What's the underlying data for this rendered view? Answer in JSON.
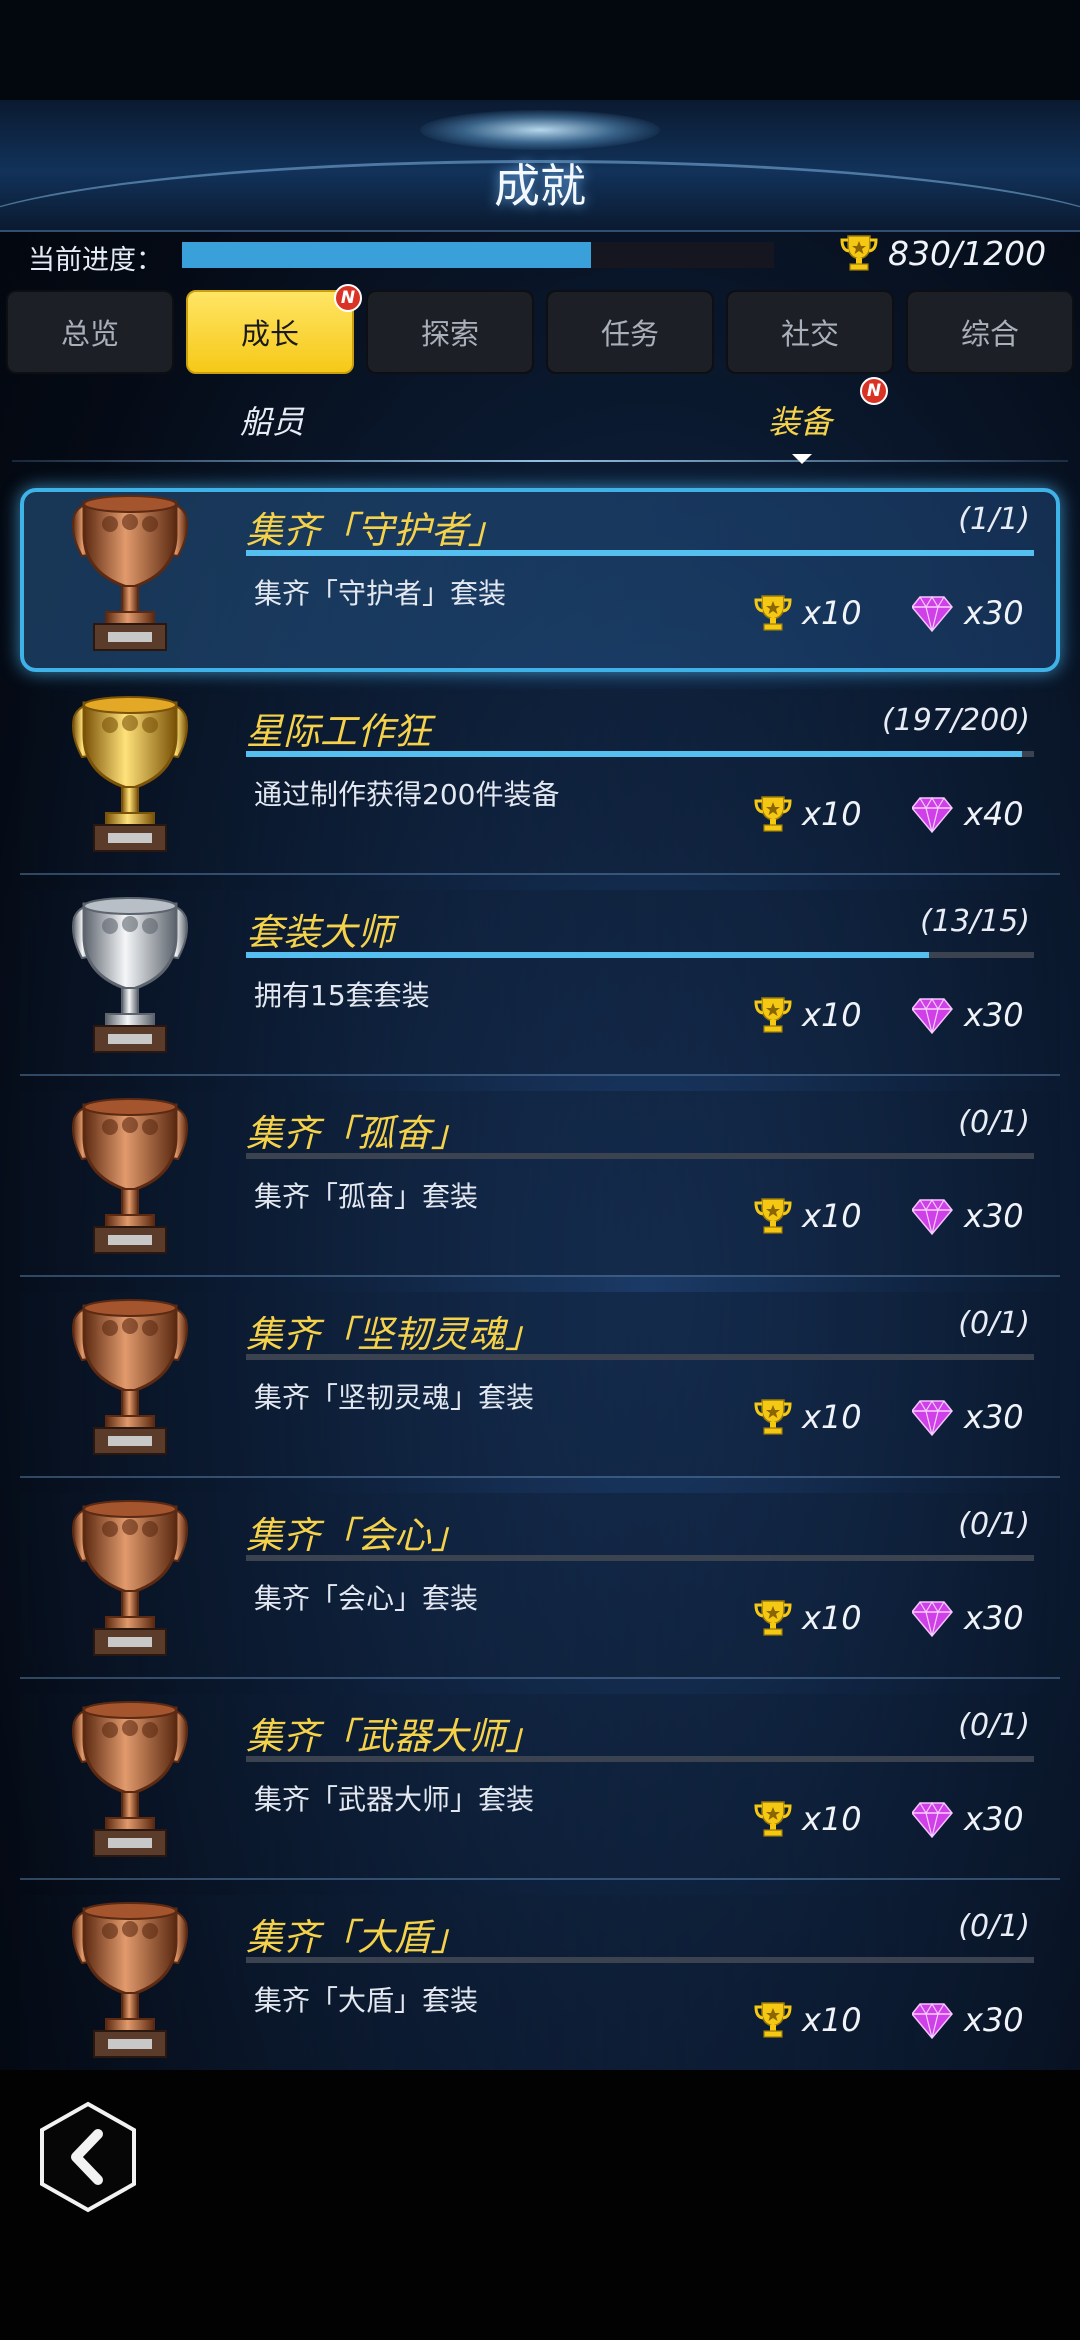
{
  "header": {
    "title": "成就"
  },
  "progress": {
    "label": "当前进度：",
    "current": 830,
    "total": 1200,
    "text": "830/1200"
  },
  "tabs": [
    {
      "label": "总览",
      "active": false,
      "badge": ""
    },
    {
      "label": "成长",
      "active": true,
      "badge": "N"
    },
    {
      "label": "探索",
      "active": false,
      "badge": ""
    },
    {
      "label": "任务",
      "active": false,
      "badge": ""
    },
    {
      "label": "社交",
      "active": false,
      "badge": ""
    },
    {
      "label": "综合",
      "active": false,
      "badge": ""
    }
  ],
  "subtabs": [
    {
      "label": "船员",
      "active": false,
      "badge": ""
    },
    {
      "label": "装备",
      "active": true,
      "badge": "N"
    }
  ],
  "achievements": [
    {
      "title": "集齐「守护者」",
      "desc": "集齐「守护者」套装",
      "progress_text": "(1/1)",
      "current": 1,
      "total": 1,
      "trophy": "bronze",
      "reward_trophy": "x10",
      "reward_gem": "x30",
      "highlight": true
    },
    {
      "title": "星际工作狂",
      "desc": "通过制作获得200件装备",
      "progress_text": "(197/200)",
      "current": 197,
      "total": 200,
      "trophy": "gold",
      "reward_trophy": "x10",
      "reward_gem": "x40",
      "highlight": false
    },
    {
      "title": "套装大师",
      "desc": "拥有15套套装",
      "progress_text": "(13/15)",
      "current": 13,
      "total": 15,
      "trophy": "silver",
      "reward_trophy": "x10",
      "reward_gem": "x30",
      "highlight": false
    },
    {
      "title": "集齐「孤奋」",
      "desc": "集齐「孤奋」套装",
      "progress_text": "(0/1)",
      "current": 0,
      "total": 1,
      "trophy": "bronze",
      "reward_trophy": "x10",
      "reward_gem": "x30",
      "highlight": false
    },
    {
      "title": "集齐「坚韧灵魂」",
      "desc": "集齐「坚韧灵魂」套装",
      "progress_text": "(0/1)",
      "current": 0,
      "total": 1,
      "trophy": "bronze",
      "reward_trophy": "x10",
      "reward_gem": "x30",
      "highlight": false
    },
    {
      "title": "集齐「会心」",
      "desc": "集齐「会心」套装",
      "progress_text": "(0/1)",
      "current": 0,
      "total": 1,
      "trophy": "bronze",
      "reward_trophy": "x10",
      "reward_gem": "x30",
      "highlight": false
    },
    {
      "title": "集齐「武器大师」",
      "desc": "集齐「武器大师」套装",
      "progress_text": "(0/1)",
      "current": 0,
      "total": 1,
      "trophy": "bronze",
      "reward_trophy": "x10",
      "reward_gem": "x30",
      "highlight": false
    },
    {
      "title": "集齐「大盾」",
      "desc": "集齐「大盾」套装",
      "progress_text": "(0/1)",
      "current": 0,
      "total": 1,
      "trophy": "bronze",
      "reward_trophy": "x10",
      "reward_gem": "x30",
      "highlight": false
    }
  ],
  "colors": {
    "accent_yellow": "#f5d24a",
    "tab_active": "#f6c918",
    "progress_fill": "#3aa0da",
    "bar_fill": "#55c0f0",
    "gem": "#d040e8",
    "bronze": "#b8673e",
    "gold": "#e2a826",
    "silver": "#c4c9d0"
  },
  "icons": {
    "reward_trophy": "trophy-icon",
    "reward_gem": "gem-icon",
    "back": "chevron-left-icon"
  }
}
